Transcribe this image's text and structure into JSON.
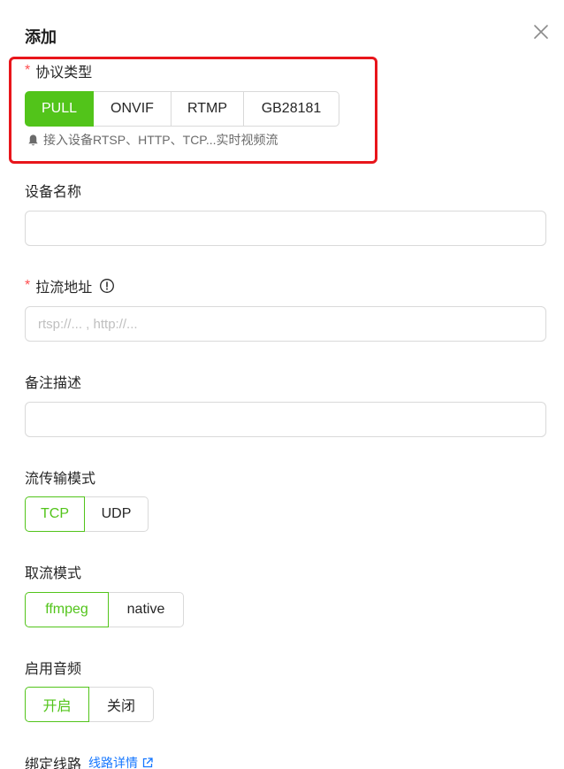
{
  "dialog": {
    "title": "添加"
  },
  "colors": {
    "primary": "#52c41a",
    "required": "#ff4d4f",
    "highlight": "#e8151b",
    "link": "#1677ff"
  },
  "protocol": {
    "required_mark": "*",
    "label": "协议类型",
    "options": [
      "PULL",
      "ONVIF",
      "RTMP",
      "GB28181"
    ],
    "selected": "PULL",
    "hint": "接入设备RTSP、HTTP、TCP...实时视频流",
    "hint_icon": "bell-icon"
  },
  "device_name": {
    "label": "设备名称",
    "value": "",
    "placeholder": ""
  },
  "pull_url": {
    "required_mark": "*",
    "label": "拉流地址",
    "info_icon": "info-circle-icon",
    "value": "",
    "placeholder": "rtsp://... , http://..."
  },
  "remark": {
    "label": "备注描述",
    "value": "",
    "placeholder": ""
  },
  "transport": {
    "label": "流传输模式",
    "options": [
      "TCP",
      "UDP"
    ],
    "selected": "TCP"
  },
  "fetch_mode": {
    "label": "取流模式",
    "options": [
      "ffmpeg",
      "native"
    ],
    "selected": "ffmpeg"
  },
  "audio": {
    "label": "启用音频",
    "options": [
      "开启",
      "关闭"
    ],
    "selected": "开启"
  },
  "route": {
    "label": "绑定线路",
    "link_label": "线路详情",
    "link_icon": "external-link-icon"
  }
}
